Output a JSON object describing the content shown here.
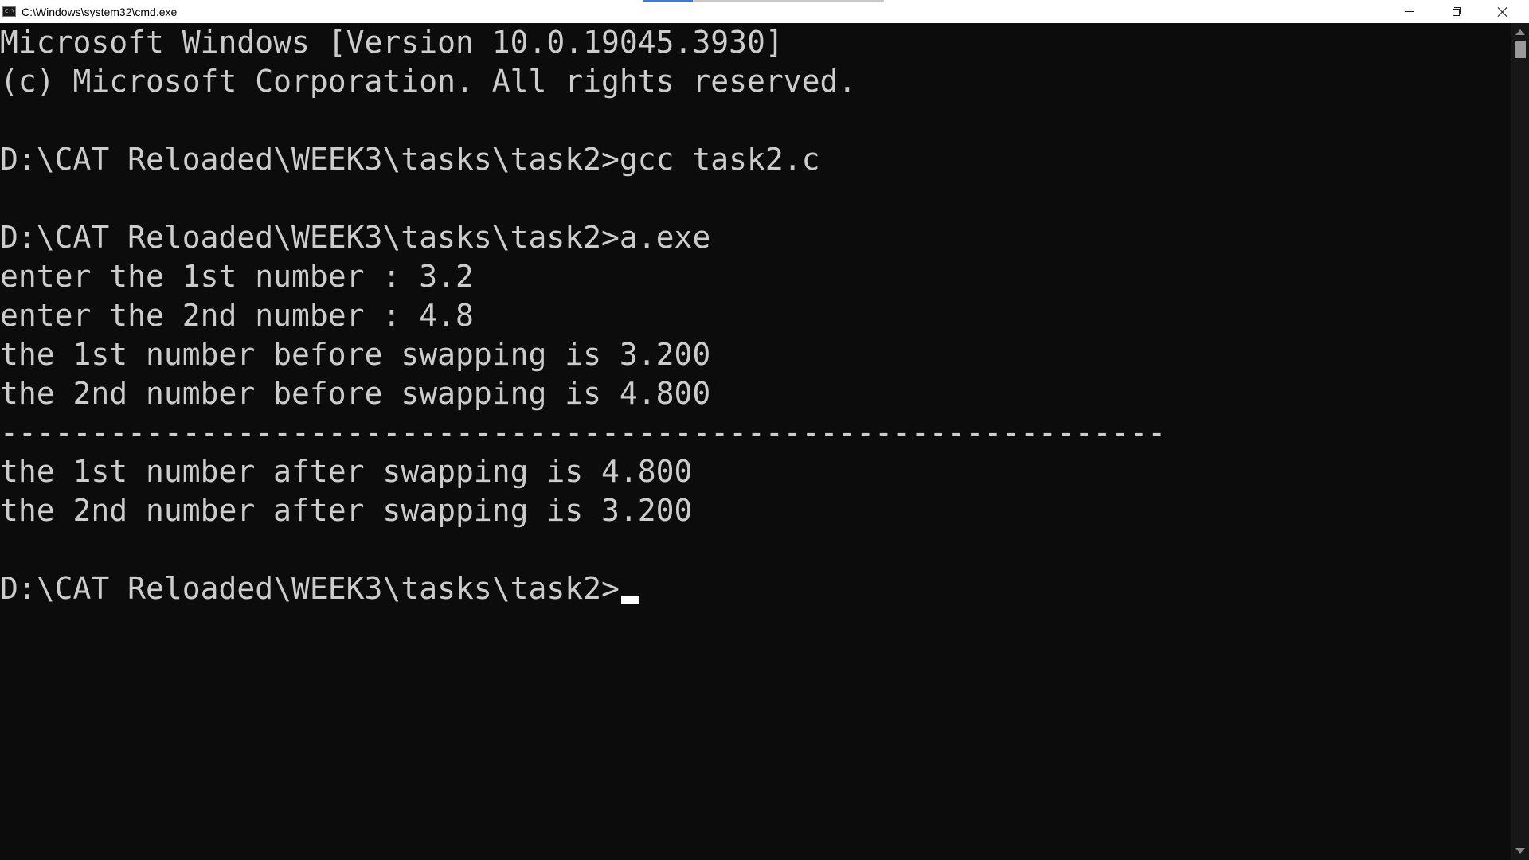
{
  "window": {
    "title": "C:\\Windows\\system32\\cmd.exe",
    "icon_label": "C:\\",
    "icons": {
      "app": "cmd-icon",
      "minimize": "minimize-icon",
      "maximize": "restore-icon",
      "close": "close-icon"
    }
  },
  "console": {
    "lines": [
      "Microsoft Windows [Version 10.0.19045.3930]",
      "(c) Microsoft Corporation. All rights reserved.",
      "",
      "D:\\CAT Reloaded\\WEEK3\\tasks\\task2>gcc task2.c",
      "",
      "D:\\CAT Reloaded\\WEEK3\\tasks\\task2>a.exe",
      "enter the 1st number : 3.2",
      "enter the 2nd number : 4.8",
      "the 1st number before swapping is 3.200",
      "the 2nd number before swapping is 4.800",
      "----------------------------------------------------------------",
      "the 1st number after swapping is 4.800",
      "the 2nd number after swapping is 3.200",
      "",
      "D:\\CAT Reloaded\\WEEK3\\tasks\\task2>"
    ],
    "text_color": "#cccccc",
    "background_color": "#0c0c0c"
  }
}
